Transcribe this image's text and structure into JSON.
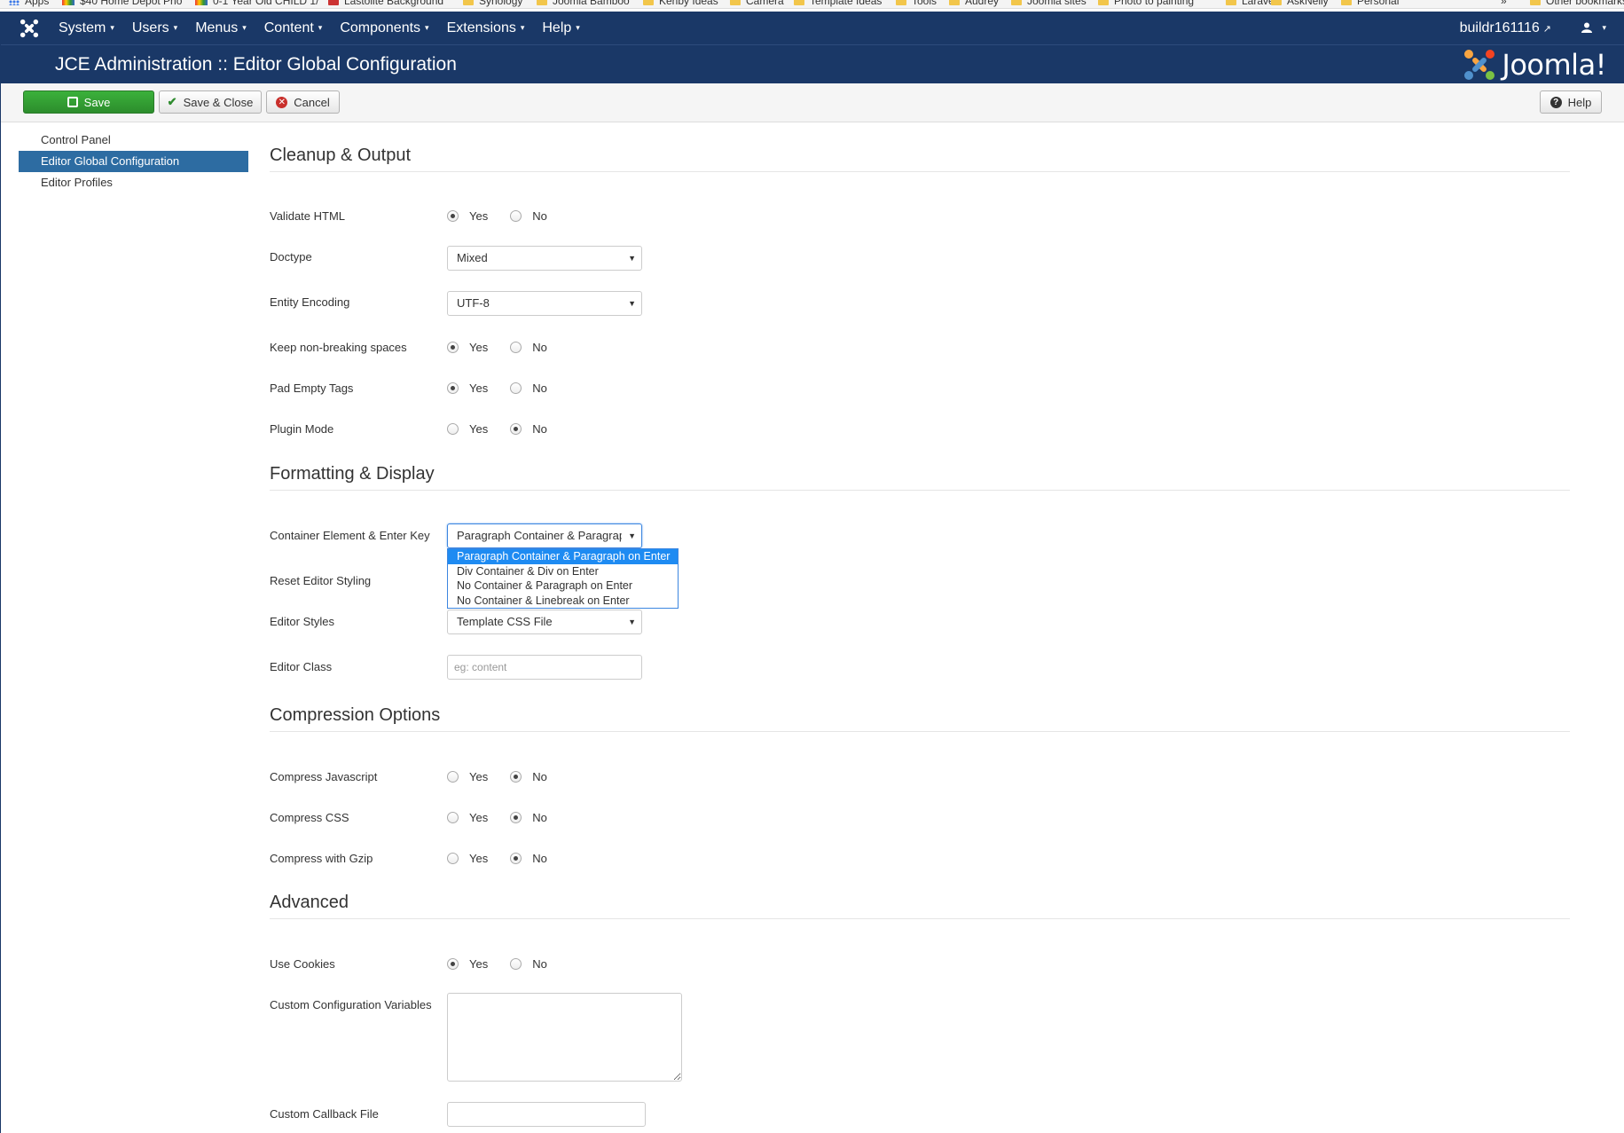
{
  "bookmarks": [
    {
      "label": "Apps",
      "icon": "apps-grid-icon"
    },
    {
      "label": "$40 Home Depot Pho",
      "icon": "colored-icon"
    },
    {
      "label": "0-1 Year Old CHILD 1/",
      "icon": "colored-icon"
    },
    {
      "label": "Lastolite Background",
      "icon": "site-icon"
    },
    {
      "label": "Synology",
      "icon": "folder-icon"
    },
    {
      "label": "Joomla Bamboo",
      "icon": "folder-icon"
    },
    {
      "label": "Kenby Ideas",
      "icon": "folder-icon"
    },
    {
      "label": "Camera",
      "icon": "folder-icon"
    },
    {
      "label": "Template Ideas",
      "icon": "folder-icon"
    },
    {
      "label": "Tools",
      "icon": "folder-icon"
    },
    {
      "label": "Audrey",
      "icon": "folder-icon"
    },
    {
      "label": "Joomla sites",
      "icon": "folder-icon"
    },
    {
      "label": "Photo to painting",
      "icon": "folder-icon"
    },
    {
      "label": "Laravel",
      "icon": "folder-icon"
    },
    {
      "label": "AskNelly",
      "icon": "folder-icon"
    },
    {
      "label": "Personal",
      "icon": "folder-icon"
    },
    {
      "label": "»",
      "icon": ""
    },
    {
      "label": "Other bookmarks",
      "icon": "folder-icon"
    }
  ],
  "topnav": {
    "menu": [
      "System",
      "Users",
      "Menus",
      "Content",
      "Components",
      "Extensions",
      "Help"
    ],
    "user": "buildr161116",
    "user_icon": "user-icon",
    "caret": "▾",
    "ext_icon": "↗"
  },
  "header": {
    "title": "JCE Administration :: Editor Global Configuration",
    "brand": "Joomla!"
  },
  "toolbar": {
    "save": "Save",
    "save_close": "Save & Close",
    "cancel": "Cancel",
    "help": "Help"
  },
  "sidebar": {
    "items": [
      {
        "label": "Control Panel",
        "active": false
      },
      {
        "label": "Editor Global Configuration",
        "active": true
      },
      {
        "label": "Editor Profiles",
        "active": false
      }
    ]
  },
  "yes": "Yes",
  "no": "No",
  "sections": {
    "cleanup": {
      "title": "Cleanup & Output",
      "validate_html": {
        "label": "Validate HTML",
        "value": "Yes"
      },
      "doctype": {
        "label": "Doctype",
        "value": "Mixed"
      },
      "entity_encoding": {
        "label": "Entity Encoding",
        "value": "UTF-8"
      },
      "keep_nbsp": {
        "label": "Keep non-breaking spaces",
        "value": "Yes"
      },
      "pad_empty": {
        "label": "Pad Empty Tags",
        "value": "Yes"
      },
      "plugin_mode": {
        "label": "Plugin Mode",
        "value": "No"
      }
    },
    "formatting": {
      "title": "Formatting & Display",
      "container": {
        "label": "Container Element & Enter Key",
        "value": "Paragraph Container & Paragraph on Enter",
        "options": [
          "Paragraph Container & Paragraph on Enter",
          "Div Container & Div on Enter",
          "No Container & Paragraph on Enter",
          "No Container & Linebreak on Enter"
        ]
      },
      "reset_styling": {
        "label": "Reset Editor Styling"
      },
      "editor_styles": {
        "label": "Editor Styles",
        "value": "Template CSS File"
      },
      "editor_class": {
        "label": "Editor Class",
        "placeholder": "eg: content"
      }
    },
    "compression": {
      "title": "Compression Options",
      "js": {
        "label": "Compress Javascript",
        "value": "No"
      },
      "css": {
        "label": "Compress CSS",
        "value": "No"
      },
      "gzip": {
        "label": "Compress with Gzip",
        "value": "No"
      }
    },
    "advanced": {
      "title": "Advanced",
      "cookies": {
        "label": "Use Cookies",
        "value": "Yes"
      },
      "custom_vars": {
        "label": "Custom Configuration Variables",
        "value": ""
      },
      "callback_file": {
        "label": "Custom Callback File",
        "value": ""
      }
    }
  },
  "colors": {
    "navbar": "#1a3867",
    "save_button": "#2c8d2c",
    "sidebar_active": "#2d6ca2",
    "dropdown_selected": "#1e8bf2"
  }
}
